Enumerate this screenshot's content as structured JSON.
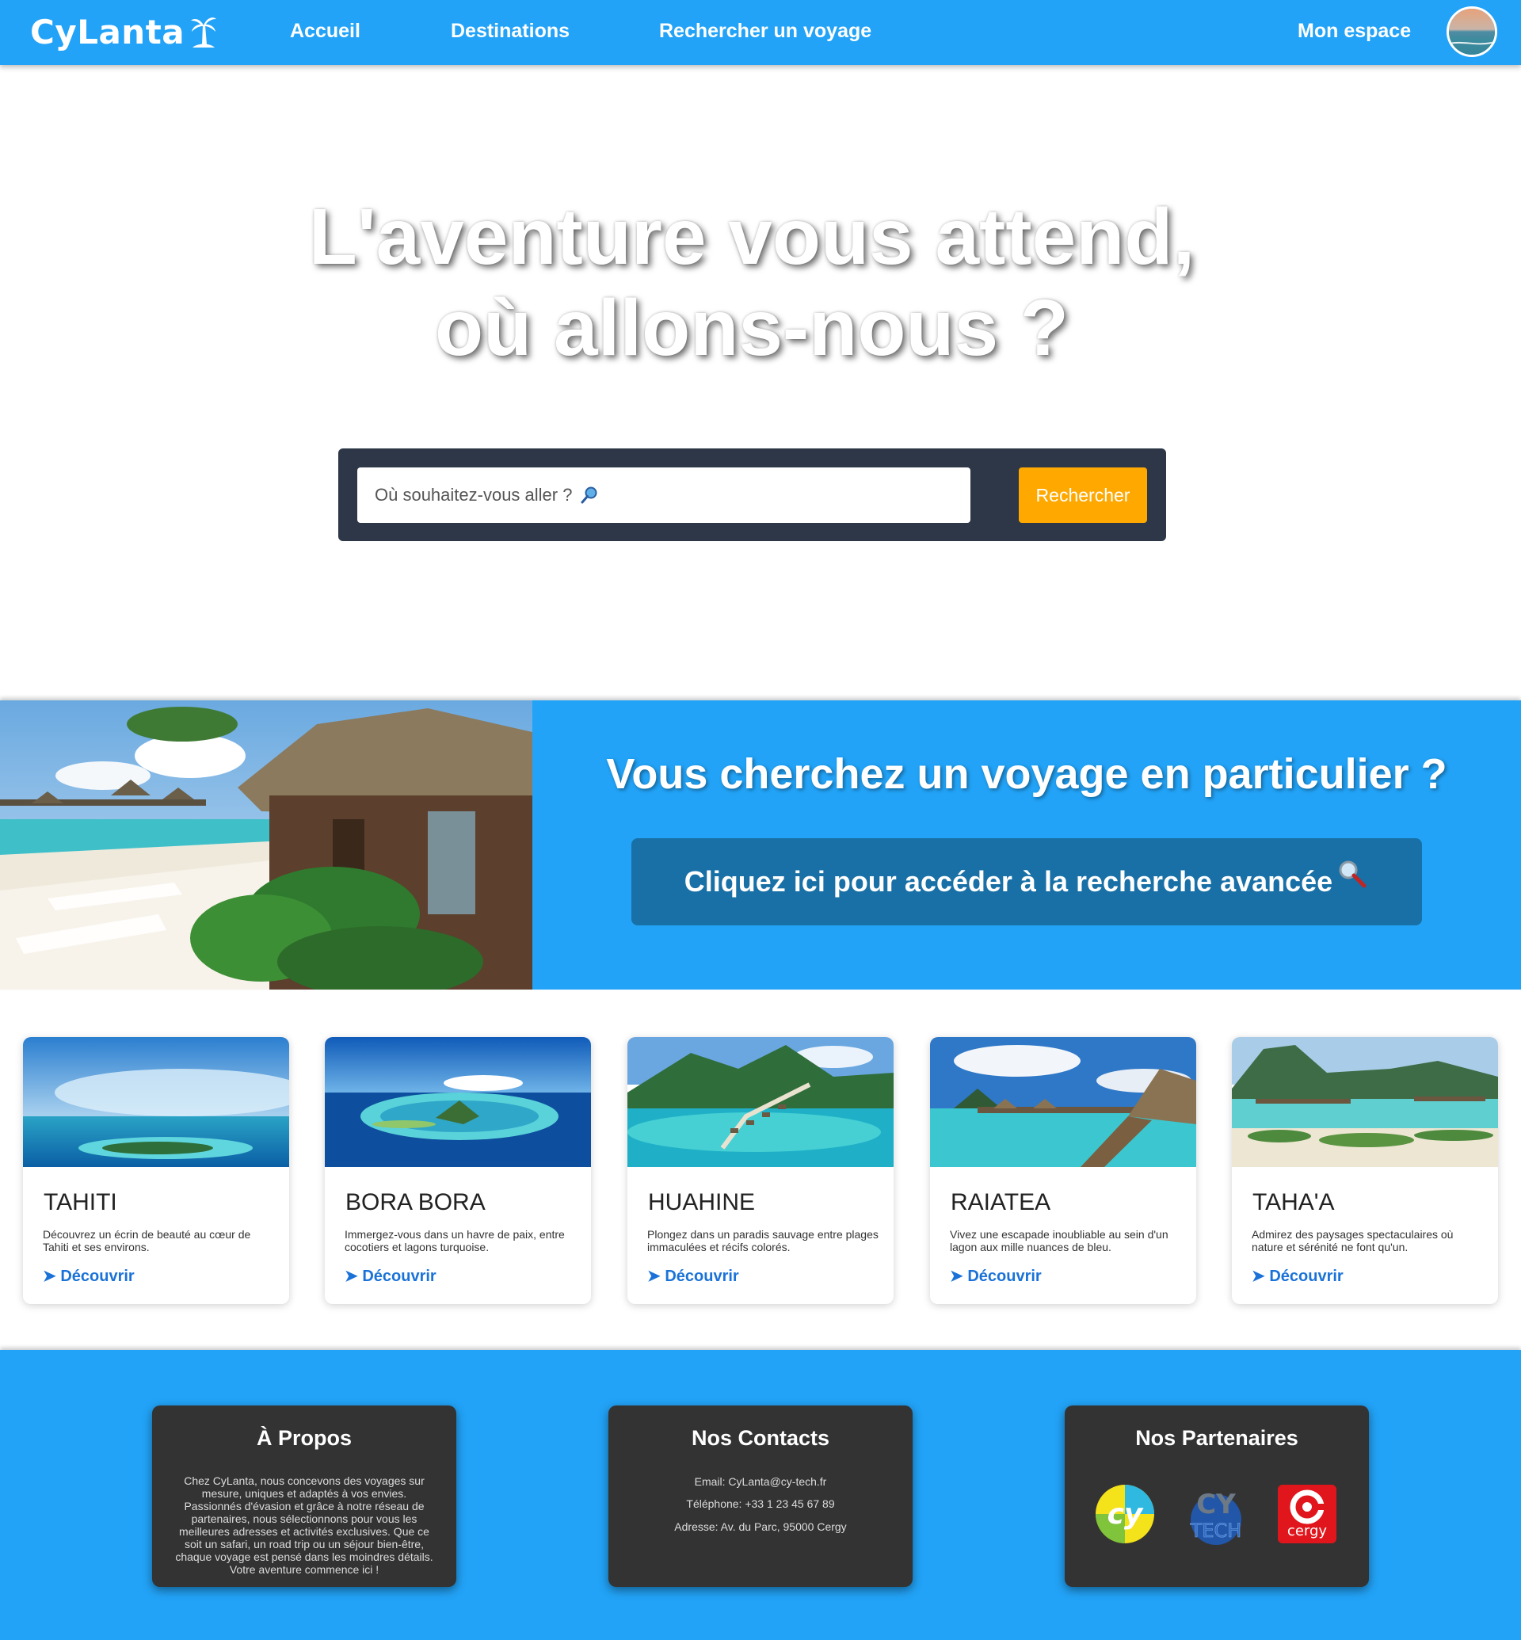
{
  "brand": {
    "name": "CyLanta"
  },
  "nav": {
    "accueil": "Accueil",
    "destinations": "Destinations",
    "search": "Rechercher un voyage",
    "account": "Mon espace"
  },
  "hero": {
    "title_line1": "L'aventure vous attend,",
    "title_line2": "où allons-nous ?",
    "search_placeholder": "Où souhaitez-vous aller ?",
    "search_button": "Rechercher"
  },
  "promo": {
    "title": "Vous cherchez un voyage en particulier ?",
    "button": "Cliquez ici pour accéder à la recherche avancée"
  },
  "destinations": [
    {
      "name": "TAHITI",
      "description": "Découvrez un écrin de beauté au cœur de Tahiti et ses environs.",
      "link": "Découvrir"
    },
    {
      "name": "BORA BORA",
      "description": "Immergez-vous dans un havre de paix, entre cocotiers et lagons turquoise.",
      "link": "Découvrir"
    },
    {
      "name": "HUAHINE",
      "description": "Plongez dans un paradis sauvage entre plages immaculées et récifs colorés.",
      "link": "Découvrir"
    },
    {
      "name": "RAIATEA",
      "description": "Vivez une escapade inoubliable au sein d'un lagon aux mille nuances de bleu.",
      "link": "Découvrir"
    },
    {
      "name": "TAHA'A",
      "description": "Admirez des paysages spectaculaires où nature et sérénité ne font qu'un.",
      "link": "Découvrir"
    }
  ],
  "footer": {
    "about": {
      "title": "À Propos",
      "text": "Chez CyLanta, nous concevons des voyages sur mesure, uniques et adaptés à vos envies. Passionnés d'évasion et grâce à notre réseau de partenaires, nous sélectionnons pour vous les meilleures adresses et activités exclusives. Que ce soit un safari, un road trip ou un séjour bien-être, chaque voyage est pensé dans les moindres détails. Votre aventure commence ici !"
    },
    "contacts": {
      "title": "Nos Contacts",
      "email": "Email: CyLanta@cy-tech.fr",
      "phone": "Téléphone: +33 1 23 45 67 89",
      "address": "Adresse: Av. du Parc, 95000 Cergy"
    },
    "partners": {
      "title": "Nos Partenaires",
      "logos": [
        "cy",
        "CY TECH",
        "cergy"
      ]
    }
  },
  "colors": {
    "primary": "#22a3f7",
    "accent": "#ffa800",
    "dark": "#2d3748",
    "button_dark": "#1870a6",
    "footer_box": "#333333",
    "link": "#1a72d8"
  },
  "icons": {
    "logo": "palm-tree-icon",
    "search": "magnifier-icon",
    "link_arrow": "arrow-right-icon"
  }
}
